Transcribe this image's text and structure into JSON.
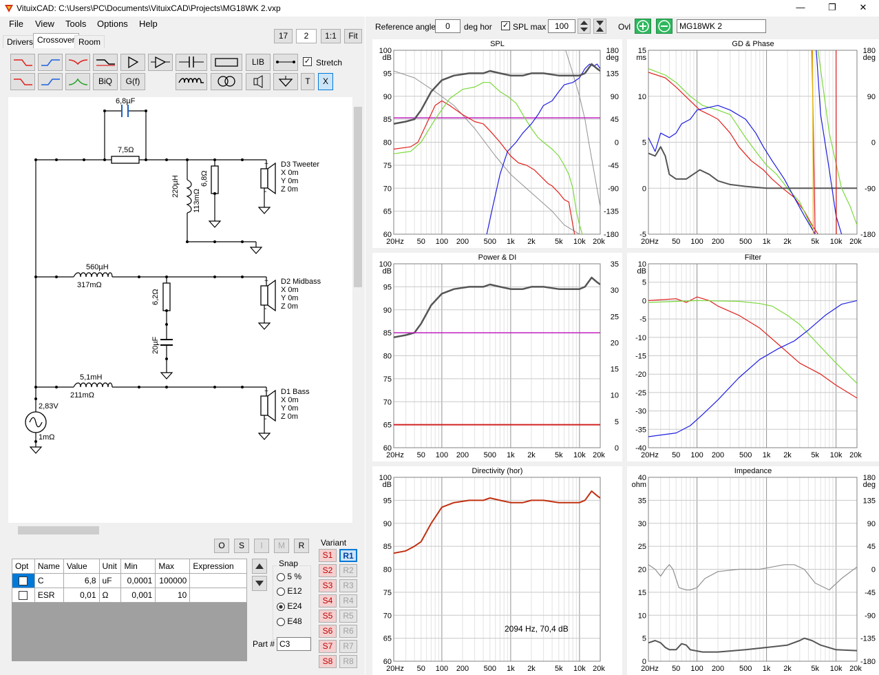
{
  "window": {
    "title": "VituixCAD: C:\\Users\\PC\\Documents\\VituixCAD\\Projects\\MG18WK 2.vxp",
    "controls": [
      "—",
      "❐",
      "✕"
    ]
  },
  "menu": [
    "File",
    "View",
    "Tools",
    "Options",
    "Help"
  ],
  "tabs": [
    "Drivers",
    "Crossover",
    "Room"
  ],
  "zoom_controls": {
    "v1": "17",
    "v2": "2",
    "one": "1:1",
    "fit": "Fit"
  },
  "toolbar": {
    "lib": "LIB",
    "biq": "BiQ",
    "gf": "G(f)",
    "t": "T",
    "x": "X",
    "stretch_label": "Stretch",
    "stretch_checked": true
  },
  "schematic": {
    "c1": "6,8µF",
    "r1": "7,5Ω",
    "l1_value": "220µH",
    "l1_esr": "113mΩ",
    "r2": "6,8Ω",
    "d3_name": "D3 Tweeter",
    "d2_name": "D2 Midbass",
    "d1_name": "D1 Bass",
    "pos_x": "X 0m",
    "pos_y": "Y 0m",
    "pos_z": "Z 0m",
    "l2_value": "560µH",
    "l2_esr": "317mΩ",
    "r3": "6,2Ω",
    "c2": "20µF",
    "l3_value": "5,1mH",
    "l3_esr": "211mΩ",
    "source_v": "2,83V",
    "source_r": "1mΩ",
    "plus": "+",
    "minus": "-"
  },
  "osirm": [
    "O",
    "S",
    "I",
    "M",
    "R"
  ],
  "parts_table": {
    "headers": [
      "Opt",
      "Name",
      "Value",
      "Unit",
      "Min",
      "Max",
      "Expression"
    ],
    "rows": [
      {
        "name": "C",
        "value": "6,8",
        "unit": "uF",
        "min": "0,0001",
        "max": "100000"
      },
      {
        "name": "ESR",
        "value": "0,01",
        "unit": "Ω",
        "min": "0,001",
        "max": "10"
      }
    ]
  },
  "snap": {
    "label": "Snap",
    "options": [
      "5 %",
      "E12",
      "E24",
      "E48"
    ],
    "selected": "E24"
  },
  "part_number": {
    "label": "Part #",
    "value": "C3"
  },
  "variant": {
    "label": "Variant",
    "s": [
      "S1",
      "S2",
      "S3",
      "S4",
      "S5",
      "S6",
      "S7",
      "S8"
    ],
    "r": [
      "R1",
      "R2",
      "R3",
      "R4",
      "R5",
      "R6",
      "R7",
      "R8"
    ]
  },
  "top_controls": {
    "ref_label": "Reference angle",
    "ref_value": "0",
    "ref_unit": "deg hor",
    "splmax_label": "SPL max",
    "splmax_value": "100",
    "ovl_label": "Ovl",
    "ovl_value": "MG18WK 2"
  },
  "colors": {
    "tweeter": "#e0201c",
    "mid": "#7bd93b",
    "bass": "#1c1ce0",
    "total": "#555555",
    "magenta": "#c020c0",
    "grey": "#909090"
  },
  "freq_ticks": [
    "20Hz",
    "50",
    "100",
    "200",
    "500",
    "1k",
    "2k",
    "5k",
    "10k",
    "20k"
  ],
  "charts": [
    {
      "id": "spl",
      "title": "SPL",
      "ytop": "dB",
      "yticks": [
        "100",
        "95",
        "90",
        "85",
        "80",
        "75",
        "70",
        "65",
        "60"
      ],
      "rtop": "deg",
      "rticks": [
        "180",
        "135",
        "90",
        "45",
        "0",
        "-45",
        "-90",
        "-135",
        "-180"
      ]
    },
    {
      "id": "gd",
      "title": "GD & Phase",
      "ytop": "ms",
      "yticks": [
        "15",
        "10",
        "5",
        "0",
        "-5"
      ],
      "rtop": "deg",
      "rticks": [
        "180",
        "90",
        "0",
        "-90",
        "-180"
      ]
    },
    {
      "id": "pdi",
      "title": "Power & DI",
      "ytop": "dB",
      "yticks": [
        "100",
        "95",
        "90",
        "85",
        "80",
        "75",
        "70",
        "65",
        "60"
      ],
      "rtop": "",
      "rticks": [
        "35",
        "30",
        "25",
        "20",
        "15",
        "10",
        "5",
        "0"
      ]
    },
    {
      "id": "filter",
      "title": "Filter",
      "ytop": "dB",
      "yticks": [
        "10",
        "5",
        "0",
        "-5",
        "-10",
        "-15",
        "-20",
        "-25",
        "-30",
        "-35",
        "-40"
      ],
      "rtop": "",
      "rticks": []
    },
    {
      "id": "dir",
      "title": "Directivity (hor)",
      "ytop": "dB",
      "yticks": [
        "100",
        "95",
        "90",
        "85",
        "80",
        "75",
        "70",
        "65",
        "60"
      ],
      "rtop": "",
      "rticks": [],
      "annotation": "2094 Hz, 70,4 dB"
    },
    {
      "id": "imp",
      "title": "Impedance",
      "ytop": "ohm",
      "yticks": [
        "40",
        "35",
        "30",
        "25",
        "20",
        "15",
        "10",
        "5",
        "0"
      ],
      "rtop": "deg",
      "rticks": [
        "180",
        "135",
        "90",
        "45",
        "0",
        "-45",
        "-90",
        "-135",
        "-180"
      ]
    }
  ]
}
